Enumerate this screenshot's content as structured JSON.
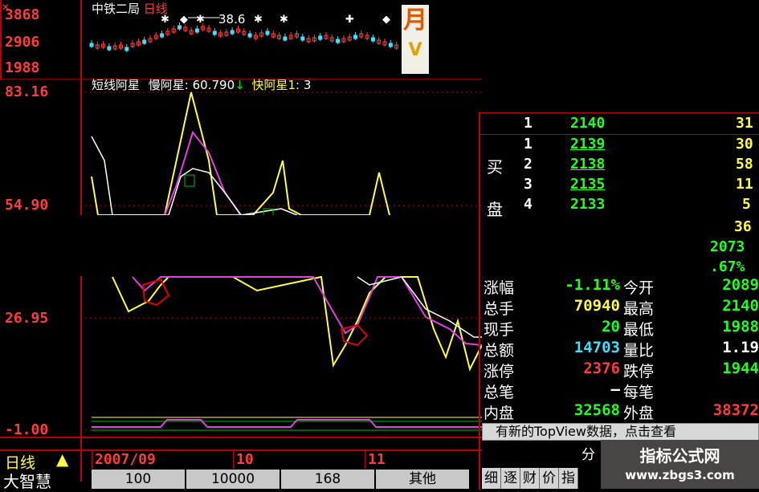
{
  "header": {
    "stock_name": "中铁二局",
    "period": "日线",
    "ma_label": "38.6"
  },
  "top_axis": [
    "3868",
    "2906",
    "1988"
  ],
  "indicator": {
    "name": "短线阿星",
    "slow_label": "慢阿星:",
    "slow_value": "60.790",
    "slow_arrow": "↓",
    "fast_label": "快阿星1:",
    "fast_value": "3"
  },
  "main_axis": [
    "83.16",
    "54.90",
    "26.95",
    "-1.00"
  ],
  "order_book": {
    "sell_rows": [
      {
        "level": "1",
        "price": "2140",
        "volume": "31"
      }
    ],
    "buy_label_1": "买",
    "buy_label_2": "盘",
    "buy_rows": [
      {
        "level": "1",
        "price": "2139",
        "volume": "30"
      },
      {
        "level": "2",
        "price": "2138",
        "volume": "58"
      },
      {
        "level": "3",
        "price": "2135",
        "volume": "11"
      },
      {
        "level": "4",
        "price": "2133",
        "volume": "5"
      }
    ],
    "extra_1": "36",
    "extra_2": "2073",
    "extra_3": ".67%"
  },
  "quote": {
    "rows": [
      {
        "l": "涨幅",
        "v": "-1.11%",
        "r": "今开",
        "rv": "2089"
      },
      {
        "l": "总手",
        "v": "70940",
        "r": "最高",
        "rv": "2140"
      },
      {
        "l": "现手",
        "v": "20",
        "r": "最低",
        "rv": "1988"
      },
      {
        "l": "总额",
        "v": "14703",
        "r": "量比",
        "rv": "1.19"
      },
      {
        "l": "涨停",
        "v": "2376",
        "r": "跌停",
        "rv": "1944"
      },
      {
        "l": "总笔",
        "v": "—",
        "r": "每笔",
        "rv": ""
      },
      {
        "l": "内盘",
        "v": "32568",
        "r": "外盘",
        "rv": "38372"
      }
    ]
  },
  "notice": "有新的TopView数据，点击查看",
  "notice_right": "分",
  "date_axis": {
    "period_label": "日线",
    "month1": "2007/09",
    "month2": "10",
    "month3": "11"
  },
  "bottom_left": "大智慧",
  "bottom_tabs": [
    "100",
    "10000",
    "168",
    "其他"
  ],
  "side_tabs": [
    "细",
    "逐",
    "财",
    "价",
    "指"
  ],
  "watermark_title": "指标公式网",
  "watermark_url": "www.zbgs3.com"
}
